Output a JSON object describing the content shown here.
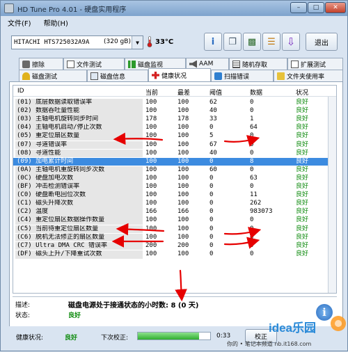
{
  "window": {
    "title": "HD Tune Pro 4.01 - 硬盘实用程序"
  },
  "menu": {
    "file": "文件(F)",
    "help": "帮助(H)"
  },
  "toolbar": {
    "drive_model": "HITACHI HTS725032A9A",
    "drive_size": "(320 gB)",
    "temperature": "33°C",
    "exit_label": "退出"
  },
  "tabs_row1": [
    {
      "label": "擦除",
      "icon": "eraser-icon"
    },
    {
      "label": "文件测试",
      "icon": "file-test-icon"
    },
    {
      "label": "磁盘监视",
      "icon": "disk-monitor-icon"
    },
    {
      "label": "AAM",
      "icon": "speaker-icon"
    },
    {
      "label": "随机存取",
      "icon": "random-access-icon"
    },
    {
      "label": "扩展测试",
      "icon": "extra-tests-icon"
    }
  ],
  "tabs_row2": [
    {
      "label": "磁盘测试",
      "icon": "benchmark-icon"
    },
    {
      "label": "磁盘信息",
      "icon": "disk-info-icon"
    },
    {
      "label": "健康状况",
      "icon": "health-cross-icon"
    },
    {
      "label": "扫描错误",
      "icon": "error-scan-icon"
    },
    {
      "label": "文件夹使用率",
      "icon": "folder-icon"
    }
  ],
  "columns": {
    "id": "ID",
    "current": "当前",
    "worst": "最差",
    "threshold": "阈值",
    "data": "数据",
    "status": "状况"
  },
  "rows": [
    {
      "id": "(01) 底层数据读取错误率",
      "cur": "100",
      "worst": "100",
      "thr": "62",
      "data": "0",
      "status": "良好"
    },
    {
      "id": "(02) 数据吞吐量性能",
      "cur": "100",
      "worst": "100",
      "thr": "40",
      "data": "0",
      "status": "良好"
    },
    {
      "id": "(03) 主轴电机旋转同步时间",
      "cur": "178",
      "worst": "178",
      "thr": "33",
      "data": "1",
      "status": "良好"
    },
    {
      "id": "(04) 主轴电机启动/停止次数",
      "cur": "100",
      "worst": "100",
      "thr": "0",
      "data": "64",
      "status": "良好"
    },
    {
      "id": "(05) 重定位扇区数量",
      "cur": "100",
      "worst": "100",
      "thr": "5",
      "data": "0",
      "status": "良好"
    },
    {
      "id": "(07) 寻道错误率",
      "cur": "100",
      "worst": "100",
      "thr": "67",
      "data": "0",
      "status": "良好"
    },
    {
      "id": "(08) 寻道性能",
      "cur": "100",
      "worst": "100",
      "thr": "40",
      "data": "0",
      "status": "良好"
    },
    {
      "id": "(09) 加电累计时间",
      "cur": "100",
      "worst": "100",
      "thr": "0",
      "data": "8",
      "status": "良好"
    },
    {
      "id": "(0A) 主轴电机重旋转同步次数",
      "cur": "100",
      "worst": "100",
      "thr": "60",
      "data": "0",
      "status": "良好"
    },
    {
      "id": "(0C) 硬盘加电次数",
      "cur": "100",
      "worst": "100",
      "thr": "0",
      "data": "63",
      "status": "良好"
    },
    {
      "id": "(BF) 冲击检测错误率",
      "cur": "100",
      "worst": "100",
      "thr": "0",
      "data": "0",
      "status": "良好"
    },
    {
      "id": "(C0) 硬盘断电回位次数",
      "cur": "100",
      "worst": "100",
      "thr": "0",
      "data": "11",
      "status": "良好"
    },
    {
      "id": "(C1) 磁头升降次数",
      "cur": "100",
      "worst": "100",
      "thr": "0",
      "data": "262",
      "status": "良好"
    },
    {
      "id": "(C2) 温度",
      "cur": "166",
      "worst": "166",
      "thr": "0",
      "data": "983073",
      "status": "良好"
    },
    {
      "id": "(C4) 重定位扇区数据操作数量",
      "cur": "100",
      "worst": "100",
      "thr": "0",
      "data": "0",
      "status": "良好"
    },
    {
      "id": "(C5) 当前待重定位扇区数量",
      "cur": "100",
      "worst": "100",
      "thr": "0",
      "data": "0",
      "status": "良好"
    },
    {
      "id": "(C6) 脱机无法修正的扇区数量",
      "cur": "100",
      "worst": "100",
      "thr": "0",
      "data": "0",
      "status": "良好"
    },
    {
      "id": "(C7) Ultra DMA CRC 错误率",
      "cur": "200",
      "worst": "200",
      "thr": "0",
      "data": "0",
      "status": "良好"
    },
    {
      "id": "(DF) 磁头上升/下降重试次数",
      "cur": "100",
      "worst": "100",
      "thr": "0",
      "data": "0",
      "status": "良好"
    }
  ],
  "selected_row": 7,
  "detail": {
    "desc_label": "描述:",
    "desc_text": "磁盘电源处于接通状态的小时数: 8 (0 天)",
    "status_label": "状态:",
    "status_value": "良好"
  },
  "status": {
    "health_label": "健康状况:",
    "health_value": "良好",
    "next_label": "下次校正:",
    "time": "0:33",
    "progress": 0.85,
    "recheck": "校正"
  },
  "watermark": {
    "brand": "idea乐园",
    "tagline": "你的 • 笔记本频道 nb.it168.com"
  },
  "colors": {
    "good": "#0c8a0c",
    "select": "#3c8be0",
    "annotation": "#e60000"
  }
}
